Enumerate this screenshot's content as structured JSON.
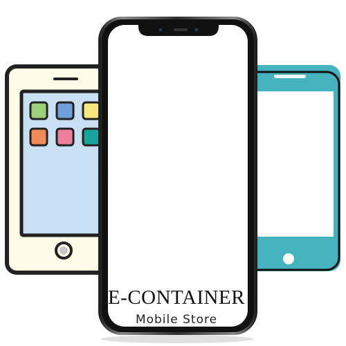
{
  "brand": {
    "title": "E-CONTAINER",
    "subtitle": "Mobile Store"
  },
  "colors": {
    "outline": "#222222",
    "cream_phone_body": "#fffbe6",
    "cream_phone_screen": "#c9dff2",
    "teal_phone": "#45b3bd",
    "app_green": "#9bd17b",
    "app_blue": "#6f9fd8",
    "app_yellow": "#f6e87a",
    "app_orange": "#f08a5b",
    "app_pink": "#ef7f9c",
    "app_teal": "#1aa39b",
    "center_phone_frame": "#3a3a3a",
    "center_phone_screen": "#ffffff"
  },
  "icons": {
    "left_phone": "cream-smartphone-icon",
    "right_phone": "teal-smartphone-icon",
    "center_phone": "bezel-less-smartphone-frame"
  }
}
